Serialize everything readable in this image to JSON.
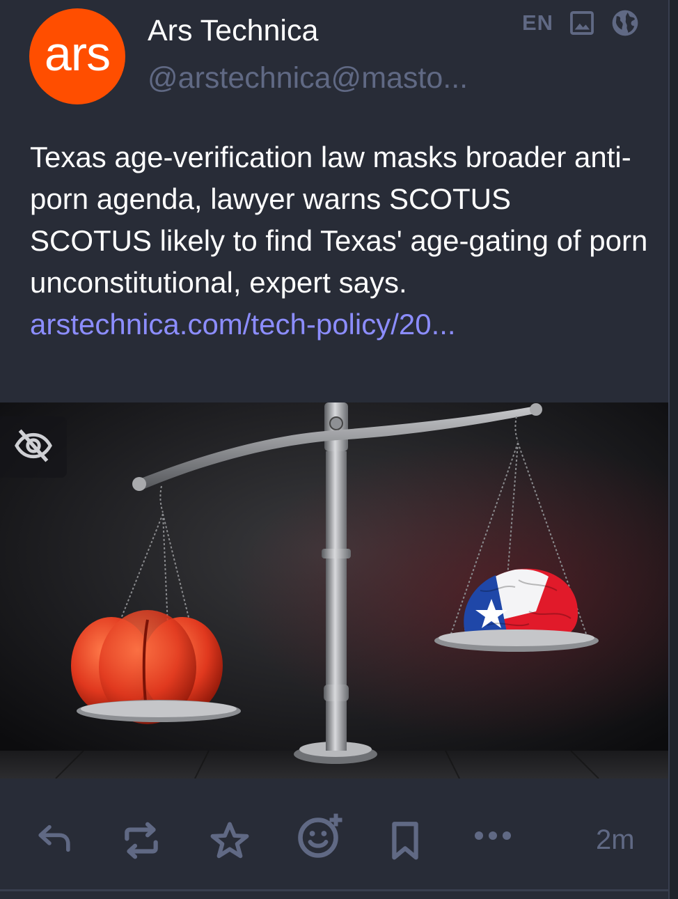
{
  "post": {
    "avatar_text": "ars",
    "display_name": "Ars Technica",
    "handle": "@arstechnica@masto...",
    "language": "EN",
    "content_lines": [
      "Texas age-verification law masks broader anti-porn agenda, lawyer warns SCOTUS",
      "SCOTUS likely to find Texas' age-gating of porn unconstitutional, expert says."
    ],
    "link": "arstechnica.com/tech-policy/20...",
    "timestamp": "2m"
  },
  "icons": {
    "meta": [
      "image-icon",
      "globe-icon"
    ],
    "media": "hide-media-icon",
    "actions": [
      "reply-icon",
      "boost-icon",
      "favourite-icon",
      "add-reaction-icon",
      "bookmark-icon",
      "more-icon"
    ]
  },
  "colors": {
    "background": "#282c37",
    "muted": "#606984",
    "link": "#8c8dff",
    "avatar": "#ff4e00"
  }
}
